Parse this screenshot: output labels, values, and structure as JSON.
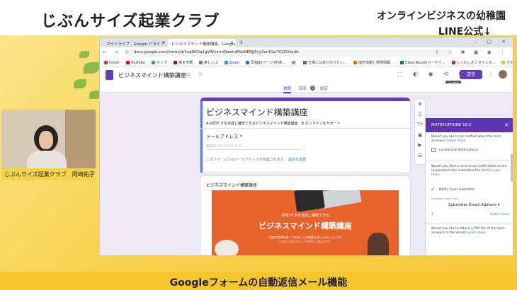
{
  "channel": {
    "title": "じぶんサイズ起業クラブ",
    "promo_line1": "オンラインビジネスの幼稚園",
    "promo_line2": "LINE公式↓",
    "caption": "Googleフォームの自動返信メール機能"
  },
  "webcam": {
    "name_tag": "じぶんサイズ起業クラブ　岡崎祐子"
  },
  "browser": {
    "tabs": [
      {
        "label": "マイドライブ - Google ドライブ",
        "active": false
      },
      {
        "label": "ビジネスマインド構築講座 - Google",
        "active": true
      }
    ],
    "new_tab": "+",
    "window_controls": "‒ ▢ ✕",
    "nav": "← → ⟳ ⌂",
    "url": "docs.google.com/forms/d/1cqEtDIq1gVRKnmnDawhdFkoNENjJPyy2xr4Gw7fQZIX/edit",
    "ext_icons": "⇪ ☆ ✱ ▣ ◉ ⋮",
    "bookmarks": [
      {
        "label": "Gmail",
        "color": "#d93025"
      },
      {
        "label": "YouTube",
        "color": "#ff0000"
      },
      {
        "label": "マップ",
        "color": "#34a853"
      },
      {
        "label": "楽天市場",
        "color": "#bf0000"
      },
      {
        "label": "楽しい.2",
        "color": "#4285f4"
      },
      {
        "label": "Zoom",
        "color": "#2d8cff"
      },
      {
        "label": "早稲田(ページ)所感…",
        "color": "#1a73e8"
      },
      {
        "label": "",
        "color": "#999999"
      },
      {
        "label": "仕事にはありなりたい…",
        "color": "#666666"
      },
      {
        "label": "成形情報と感情情報…",
        "color": "#e8710a"
      },
      {
        "label": "Class Buzzのバーサイ…",
        "color": "#0b8043"
      },
      {
        "label": "しっかしオンラインス…",
        "color": "#8e24aa"
      },
      {
        "label": "その他のブックマーク",
        "color": "#f6bf26"
      }
    ]
  },
  "forms_app": {
    "title": "ビジネスマインド構築講座",
    "header_icons": "▭ ☆",
    "right_icons": "⬚ ◐ ◉ ⟲ ⟳",
    "send_label": "送信",
    "more": "⋮",
    "tooltip": "元に戻す",
    "tabs": {
      "questions": "質問",
      "responses": "回答",
      "responses_count": "0",
      "settings": "設定"
    }
  },
  "form": {
    "title": "ビジネスマインド構築講座",
    "description": "A.円同ケタを達成し継続できるビジネスマインド構築講座　B.オンラインをサポート",
    "email_label": "メールアドレス *",
    "email_placeholder": "有効なメールアドレス",
    "email_note": "このフォームではメールアドレスが収集されます。",
    "email_change": "設定を変更",
    "section_title": "ビジネスマインド構築講座",
    "banner": {
      "subtitle": "月商7ケタを達成し継続できる",
      "title": "ビジネスマインド構築講座",
      "footer1": "月商の思考を使って何かしらの結果を手に入れたとしても",
      "footer2": "このビジネスマインドを手に入れたから！"
    }
  },
  "side_tools": [
    "⊕",
    "⎘",
    "Tт",
    "▣",
    "▶",
    "☰"
  ],
  "notifications": {
    "header": "NOTIFICATIONS 18.2",
    "close": "✕",
    "q1": "Would you like to be notified when the form answers?",
    "q1_link": "Learn more",
    "conditional_label": "Conditional Notifications",
    "q2": "Would you like to send email notification to the respondent who submitted the form?",
    "q2_link": "Learn more",
    "notify_label": "Notify Form Submitter",
    "submitter_field_label": "Submitter Email Field",
    "submitter_select": "Submitter Email Address ▾",
    "help": "?",
    "learn_more": "Learn more",
    "q3": "Would you like to attach a PDF file of the form answers to the email?",
    "q3_link": "Learn more"
  }
}
